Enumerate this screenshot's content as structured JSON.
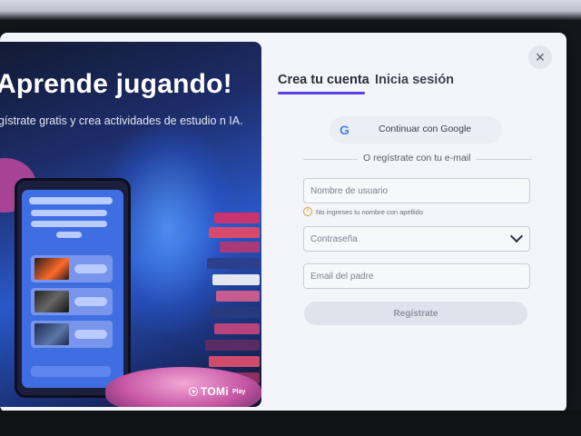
{
  "hero": {
    "title": "Aprende jugando!",
    "subtitle": "gístrate gratis y crea actividades de estudio n IA.",
    "logo": "TOMi",
    "logo_suffix": "Play"
  },
  "modal": {
    "close_glyph": "×"
  },
  "tabs": [
    {
      "label": "Crea tu cuenta",
      "active": true
    },
    {
      "label": "Inicia sesión",
      "active": false
    }
  ],
  "form": {
    "google_label": "Continuar con Google",
    "google_glyph": "G",
    "divider_label": "O regístrate con tu e-mail",
    "username_placeholder": "Nombre de usuario",
    "username_hint": "No ingreses tu nombre con apellido",
    "hint_glyph": "!",
    "password_placeholder": "Contraseña",
    "email_placeholder": "Email del padre",
    "register_label": "Regístrate"
  },
  "colors": {
    "accent": "#5a3ee6",
    "google_blue": "#4285f4",
    "warning": "#e0a01a"
  }
}
